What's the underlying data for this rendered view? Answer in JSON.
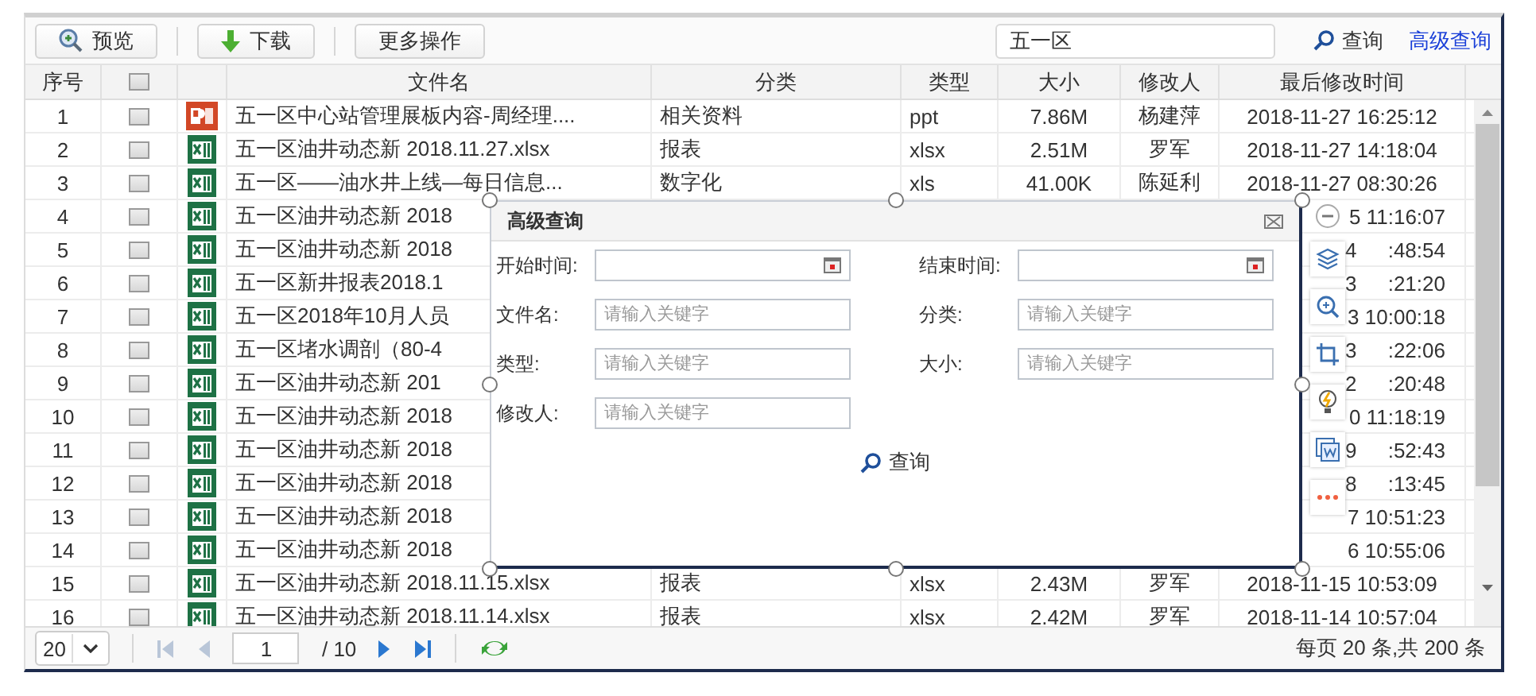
{
  "toolbar": {
    "buttons": [
      {
        "kind": "preview",
        "label": "预览"
      },
      {
        "kind": "download",
        "label": "下载"
      },
      {
        "kind": "plain",
        "label": "更多操作"
      }
    ],
    "search": {
      "value": "五一区"
    },
    "search_button": "查询",
    "advanced_link": "高级查询"
  },
  "table": {
    "columns": [
      {
        "kind": "text",
        "label": "序号"
      },
      {
        "kind": "checkbox",
        "checked": false
      },
      {
        "kind": "icon"
      },
      {
        "kind": "text",
        "label": "文件名"
      },
      {
        "kind": "text",
        "label": "分类"
      },
      {
        "kind": "text",
        "label": "类型"
      },
      {
        "kind": "text",
        "label": "大小"
      },
      {
        "kind": "text",
        "label": "修改人"
      },
      {
        "kind": "text",
        "label": "最后修改时间"
      }
    ],
    "rows": [
      {
        "no": "1",
        "checked": false,
        "kind": "presentation",
        "name": "五一区中心站管理展板内容-周经理....",
        "category": "相关资料",
        "type": "ppt",
        "size": "7.86M",
        "editor": "杨建萍",
        "modified": [
          "2018-11-27 16:25:12"
        ]
      },
      {
        "no": "2",
        "checked": false,
        "kind": "spreadsheet",
        "name": "五一区油井动态新 2018.11.27.xlsx",
        "category": "报表",
        "type": "xlsx",
        "size": "2.51M",
        "editor": "罗军",
        "modified": [
          "2018-11-27 14:18:04"
        ]
      },
      {
        "no": "3",
        "checked": false,
        "kind": "spreadsheet",
        "name": "五一区——油水井上线—每日信息...",
        "category": "数字化",
        "type": "xls",
        "size": "41.00K",
        "editor": "陈延利",
        "modified": [
          "2018-11-27 08:30:26"
        ]
      },
      {
        "no": "4",
        "checked": false,
        "kind": "spreadsheet",
        "name": "五一区油井动态新 2018",
        "modified": [
          "5 11:16:07"
        ]
      },
      {
        "no": "5",
        "checked": false,
        "kind": "spreadsheet",
        "name": "五一区油井动态新 2018",
        "modified": [
          "4",
          ":48:54"
        ]
      },
      {
        "no": "6",
        "checked": false,
        "kind": "spreadsheet",
        "name": "五一区新井报表2018.1",
        "modified": [
          "3",
          ":21:20"
        ]
      },
      {
        "no": "7",
        "checked": false,
        "kind": "spreadsheet",
        "name": "五一区2018年10月人员",
        "modified": [
          "3 10:00:18"
        ]
      },
      {
        "no": "8",
        "checked": false,
        "kind": "spreadsheet",
        "name": "五一区堵水调剖（80-4",
        "modified": [
          "3",
          ":22:06"
        ]
      },
      {
        "no": "9",
        "checked": false,
        "kind": "spreadsheet",
        "name": "五一区油井动态新 201",
        "modified": [
          "2",
          ":20:48"
        ]
      },
      {
        "no": "10",
        "checked": false,
        "kind": "spreadsheet",
        "name": "五一区油井动态新 2018",
        "modified": [
          "0 11:18:19"
        ]
      },
      {
        "no": "11",
        "checked": false,
        "kind": "spreadsheet",
        "name": "五一区油井动态新 2018",
        "modified": [
          "9",
          ":52:43"
        ]
      },
      {
        "no": "12",
        "checked": false,
        "kind": "spreadsheet",
        "name": "五一区油井动态新 2018",
        "modified": [
          "8",
          ":13:45"
        ]
      },
      {
        "no": "13",
        "checked": false,
        "kind": "spreadsheet",
        "name": "五一区油井动态新 2018",
        "modified": [
          "7 10:51:23"
        ]
      },
      {
        "no": "14",
        "checked": false,
        "kind": "spreadsheet",
        "name": "五一区油井动态新 2018",
        "modified": [
          "6 10:55:06"
        ]
      },
      {
        "no": "15",
        "checked": false,
        "kind": "spreadsheet",
        "name": "五一区油井动态新 2018.11.15.xlsx",
        "category": "报表",
        "type": "xlsx",
        "size": "2.43M",
        "editor": "罗军",
        "modified": [
          "2018-11-15 10:53:09"
        ]
      },
      {
        "no": "16",
        "checked": false,
        "kind": "spreadsheet",
        "name": "五一区油井动态新 2018.11.14.xlsx",
        "category": "报表",
        "type": "xlsx",
        "size": "2.42M",
        "editor": "罗军",
        "modified": [
          "2018-11-14 10:57:04"
        ]
      }
    ]
  },
  "pager": {
    "page_size": "20",
    "nav": [
      {
        "kind": "first",
        "disabled": true
      },
      {
        "kind": "prev",
        "disabled": true
      }
    ],
    "page": "1",
    "total": "/ 10",
    "nav_after": [
      {
        "kind": "next",
        "disabled": false
      },
      {
        "kind": "last",
        "disabled": false
      }
    ],
    "summary": "每页 20 条,共 200 条"
  },
  "dialog": {
    "title": "高级查询",
    "fields": [
      {
        "label": "开始时间:",
        "kind": "date"
      },
      {
        "label": "结束时间:",
        "kind": "date"
      },
      {
        "label": "文件名:",
        "kind": "text",
        "placeholder": "请输入关键字"
      },
      {
        "label": "分类:",
        "kind": "text",
        "placeholder": "请输入关键字"
      },
      {
        "label": "类型:",
        "kind": "text",
        "placeholder": "请输入关键字"
      },
      {
        "label": "大小:",
        "kind": "text",
        "placeholder": "请输入关键字"
      },
      {
        "label": "修改人:",
        "kind": "text",
        "placeholder": "请输入关键字"
      }
    ],
    "button": "查询"
  }
}
